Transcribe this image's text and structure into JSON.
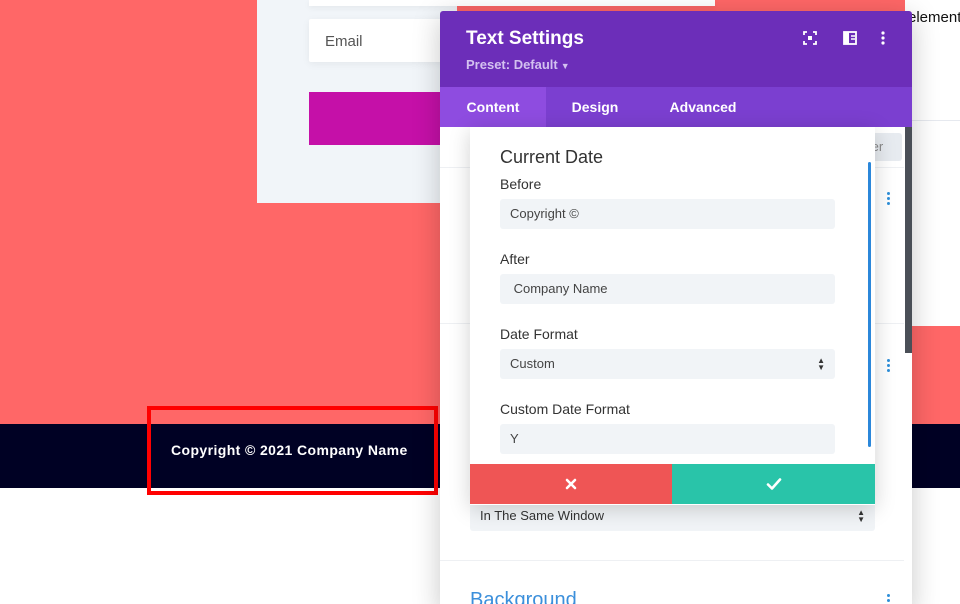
{
  "background_page": {
    "email_placeholder": "Email",
    "footer_text": "Copyright © 2021 Company Name",
    "partial_right_text": "elements",
    "colors": {
      "coral": "#ff6767",
      "footer": "#000124",
      "magenta_button": "#c510a8",
      "highlight": "#ff0000"
    }
  },
  "modal": {
    "title": "Text Settings",
    "preset": "Preset: Default",
    "header_icons": [
      "expand-icon",
      "split-view-icon",
      "more-vertical-icon"
    ],
    "tabs": [
      {
        "label": "Content",
        "active": true
      },
      {
        "label": "Design",
        "active": false
      },
      {
        "label": "Advanced",
        "active": false
      }
    ],
    "filter_label": "ter",
    "link_target_value": "In The Same Window",
    "background_section": "Background",
    "colors": {
      "header": "#6c2eb9",
      "tabs": "#7b3fd0",
      "active_tab": "#8e4ce0"
    }
  },
  "popup": {
    "title": "Current Date",
    "fields": {
      "before": {
        "label": "Before",
        "value": "Copyright ©"
      },
      "after": {
        "label": "After",
        "value": " Company Name"
      },
      "date_format": {
        "label": "Date Format",
        "value": "Custom"
      },
      "custom_date_format": {
        "label": "Custom Date Format",
        "value": "Y"
      }
    },
    "cancel_icon": "close-icon",
    "save_icon": "check-icon",
    "colors": {
      "cancel": "#ef5555",
      "save": "#29c4a9"
    }
  }
}
